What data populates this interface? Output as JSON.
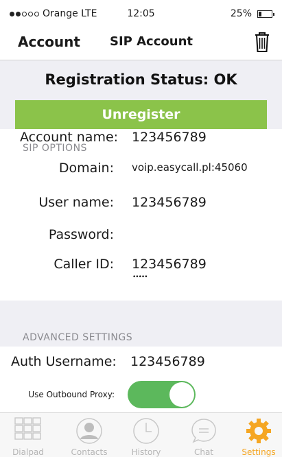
{
  "status_bar": {
    "signal_dots_filled": 2,
    "signal_dots_total": 5,
    "carrier": "Orange LTE",
    "time": "12:05",
    "battery": "25%",
    "battery_level": 0.25
  },
  "nav": {
    "back_label": "Account",
    "title": "SIP Account",
    "trash_icon": "trash-icon"
  },
  "registration": {
    "status": "Registration Status: OK",
    "unregister_label": "Unregister"
  },
  "account": {
    "name_label": "Account name:",
    "name_value": "123456789"
  },
  "sip_options": {
    "header": "SIP OPTIONS",
    "domain_label": "Domain:",
    "domain_value": "voip.easycall.pl:45060",
    "username_label": "User name:",
    "username_value": "123456789",
    "password_label": "Password:",
    "password_value": "•••••",
    "callerid_label": "Caller ID:",
    "callerid_value": "123456789"
  },
  "advanced": {
    "header": "ADVANCED SETTINGS",
    "auth_username_label": "Auth Username:",
    "auth_username_value": "123456789",
    "outbound_proxy_label": "Use Outbound Proxy:",
    "outbound_proxy_on": true
  },
  "tabs": [
    {
      "label": "Dialpad",
      "icon": "dialpad-icon",
      "active": false
    },
    {
      "label": "Contacts",
      "icon": "contacts-icon",
      "active": false
    },
    {
      "label": "History",
      "icon": "history-icon",
      "active": false
    },
    {
      "label": "Chat",
      "icon": "chat-icon",
      "active": false
    },
    {
      "label": "Settings",
      "icon": "settings-icon",
      "active": true
    }
  ],
  "colors": {
    "accent_green": "#8bc34a",
    "toggle_green": "#5cb85c",
    "active_tab": "#f5a623",
    "inactive_tab": "#b5b5b5",
    "background_gray": "#efeff4"
  }
}
